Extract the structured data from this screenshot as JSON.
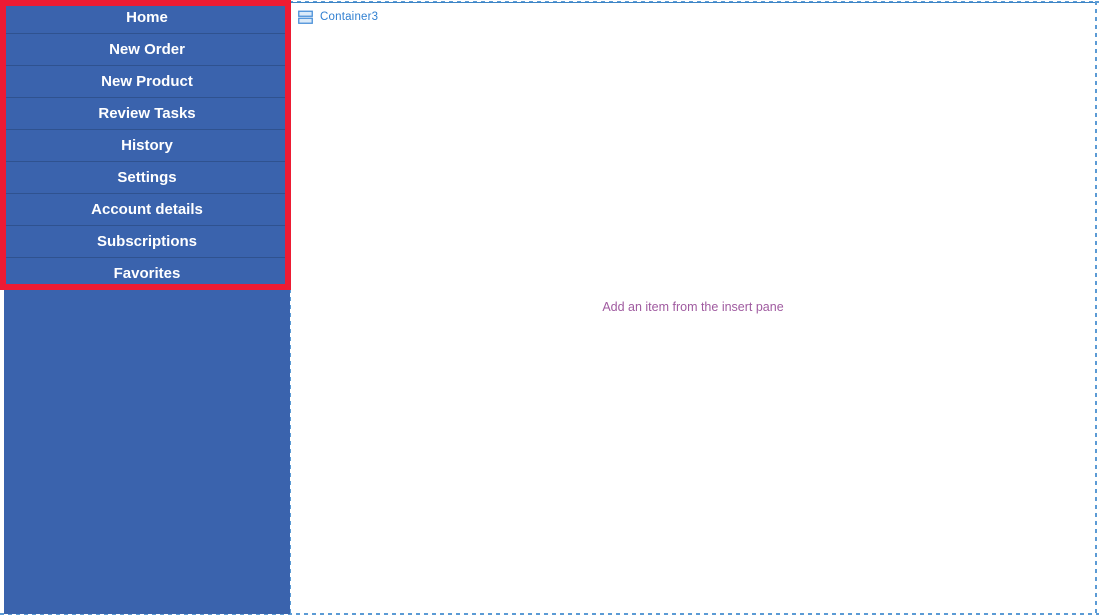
{
  "sidebar": {
    "name": "navigation-panel",
    "background_color": "#3A63AD",
    "separator_color": "#2F528F",
    "text_color": "#FFFFFF",
    "items": [
      {
        "label": "Home"
      },
      {
        "label": "New Order"
      },
      {
        "label": "New Product"
      },
      {
        "label": "Review Tasks"
      },
      {
        "label": "History"
      },
      {
        "label": "Settings"
      },
      {
        "label": "Account details"
      },
      {
        "label": "Subscriptions"
      },
      {
        "label": "Favorites"
      }
    ]
  },
  "highlight": {
    "color": "#ED1B33",
    "border_width_px": 6
  },
  "canvas": {
    "container": {
      "icon": "stacked-container-icon",
      "label": "Container3",
      "label_color": "#2F7FD1"
    },
    "empty_state": {
      "message": "Add an item from the insert pane",
      "message_color": "#A05BA0"
    },
    "border_color": "#5B9BD5",
    "top_rule_color": "#3D85C6"
  }
}
